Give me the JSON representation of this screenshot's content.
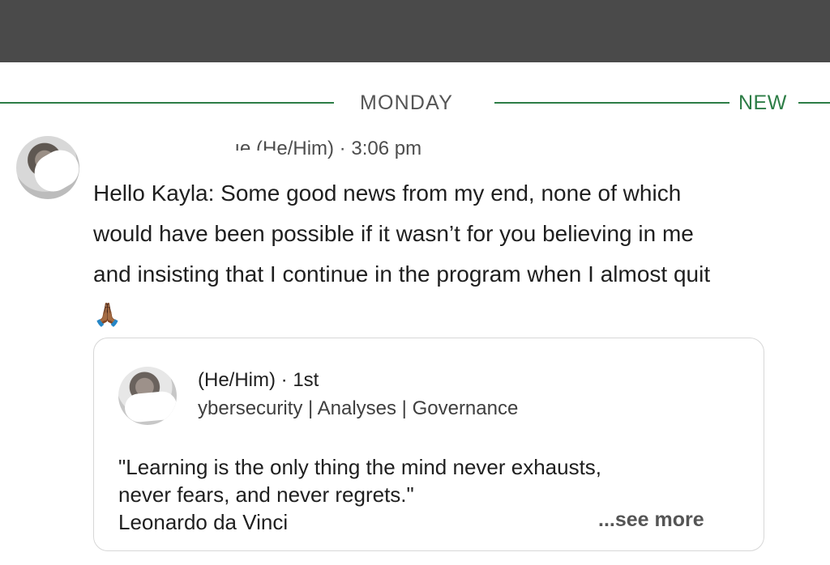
{
  "top_bar": {},
  "divider": {
    "day_label": "MONDAY",
    "new_label": "NEW",
    "accent_color": "#2d7d46"
  },
  "message": {
    "sender_header": ". .. ıe (He/Him) · 3:06 pm",
    "text": "Hello Kayla: Some good news from my end, none of which would have been possible if it wasn’t for you believing in me and insisting that I continue in the program when I almost quit",
    "emoji": "🙏🏾"
  },
  "shared_card": {
    "name_line": "(He/Him) · 1st",
    "headline": "ybersecurity | Analyses | Governance",
    "quote": "\"Learning is the only thing the mind never exhausts,\nnever fears, and never regrets.\"\nLeonardo da Vinci",
    "see_more": "...see more"
  }
}
